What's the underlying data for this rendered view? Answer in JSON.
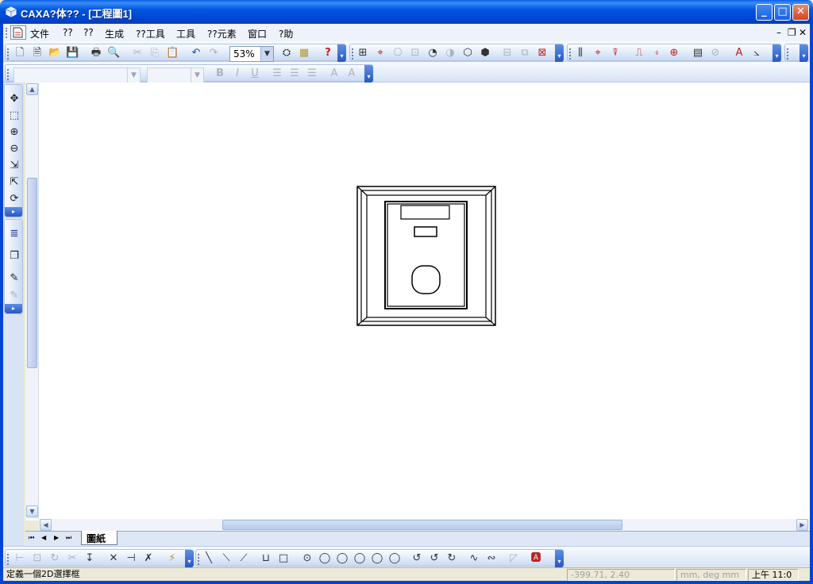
{
  "window": {
    "title": "CAXA?体?? - [工程圖1]",
    "minimize_glyph": "_",
    "maximize_glyph": "□",
    "close_glyph": "✕"
  },
  "menubar": {
    "items": [
      "文件",
      "??",
      "??",
      "生成",
      "??工具",
      "工具",
      "??元素",
      "窗口",
      "?助"
    ],
    "mdi_minimize": "–",
    "mdi_restore": "❐",
    "mdi_close": "✕"
  },
  "standard_toolbar": {
    "zoom_value": "53%"
  },
  "format_toolbar": {
    "bold": "B",
    "italic": "I",
    "underline": "U"
  },
  "sheet_tabs": {
    "nav_first": "⏮",
    "nav_prev": "◀",
    "nav_next": "▶",
    "nav_last": "⏭",
    "active_tab": "圖紙1"
  },
  "statusbar": {
    "message": "定義一個2D選擇框",
    "coordinates": "-399.71, 2.40",
    "units": "mm, deg   mm",
    "clock": "上午 11:0"
  },
  "colors": {
    "titlebar": "#0046D3",
    "canvas": "#FFFFFF",
    "toolbar": "#D6E3F6",
    "statusbar": "#ECE9D8"
  }
}
